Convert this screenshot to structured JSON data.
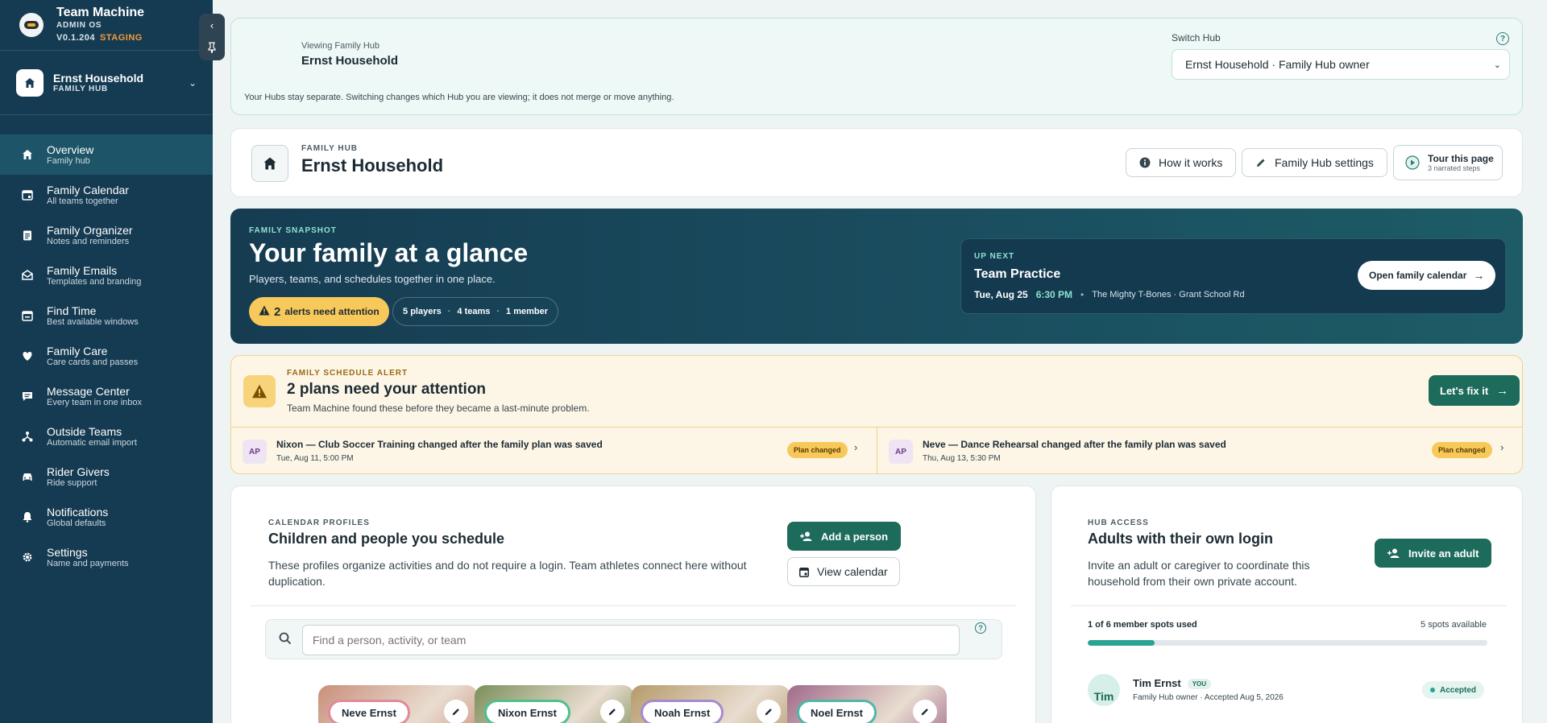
{
  "app": {
    "title": "Team Machine",
    "subtitle": "ADMIN OS",
    "version": "V0.1.204",
    "env": "STAGING"
  },
  "hub_switch": {
    "name": "Ernst Household",
    "type": "FAMILY HUB"
  },
  "nav": [
    {
      "label": "Overview",
      "sub": "Family hub",
      "icon": "home-icon",
      "active": true
    },
    {
      "label": "Family Calendar",
      "sub": "All teams together",
      "icon": "calendar-icon"
    },
    {
      "label": "Family Organizer",
      "sub": "Notes and reminders",
      "icon": "clipboard-icon"
    },
    {
      "label": "Family Emails",
      "sub": "Templates and branding",
      "icon": "mail-icon"
    },
    {
      "label": "Find Time",
      "sub": "Best available windows",
      "icon": "calendar-search-icon"
    },
    {
      "label": "Family Care",
      "sub": "Care cards and passes",
      "icon": "heart-icon"
    },
    {
      "label": "Message Center",
      "sub": "Every team in one inbox",
      "icon": "chat-icon"
    },
    {
      "label": "Outside Teams",
      "sub": "Automatic email import",
      "icon": "network-icon"
    },
    {
      "label": "Rider Givers",
      "sub": "Ride support",
      "icon": "car-icon"
    },
    {
      "label": "Notifications",
      "sub": "Global defaults",
      "icon": "bell-icon"
    },
    {
      "label": "Settings",
      "sub": "Name and payments",
      "icon": "gear-icon"
    }
  ],
  "viewing": {
    "label": "Viewing Family Hub",
    "name": "Ernst Household",
    "note": "Your Hubs stay separate. Switching changes which Hub you are viewing; it does not merge or move anything.",
    "switch_label": "Switch Hub",
    "switch_value": "Ernst Household · Family Hub owner"
  },
  "hub_header": {
    "label": "FAMILY HUB",
    "title": "Ernst Household",
    "how_it_works": "How it works",
    "settings": "Family Hub settings",
    "tour_title": "Tour this page",
    "tour_sub": "3 narrated steps"
  },
  "snapshot": {
    "label": "FAMILY SNAPSHOT",
    "title": "Your family at a glance",
    "subtitle": "Players, teams, and schedules together in one place.",
    "alerts_count": "2",
    "alerts_text": "alerts need attention",
    "players_n": "5",
    "players_l": "players",
    "teams_n": "4",
    "teams_l": "teams",
    "members_n": "1",
    "members_l": "member",
    "up_next_label": "UP NEXT",
    "up_next_title": "Team Practice",
    "up_next_date": "Tue, Aug 25",
    "up_next_time": "6:30 PM",
    "up_next_loc": "The Mighty T-Bones · Grant School Rd",
    "open_calendar": "Open family calendar"
  },
  "schedule_alert": {
    "label": "FAMILY SCHEDULE ALERT",
    "title": "2 plans need your attention",
    "subtitle": "Team Machine found these before they became a last-minute problem.",
    "fix_button": "Let's fix it",
    "items": [
      {
        "initials": "AP",
        "title": "Nixon — Club Soccer Training changed after the family plan was saved",
        "date": "Tue, Aug 11, 5:00 PM",
        "badge": "Plan changed"
      },
      {
        "initials": "AP",
        "title": "Neve — Dance Rehearsal changed after the family plan was saved",
        "date": "Thu, Aug 13, 5:30 PM",
        "badge": "Plan changed"
      }
    ]
  },
  "profiles": {
    "label": "CALENDAR PROFILES",
    "title": "Children and people you schedule",
    "desc": "These profiles organize activities and do not require a login. Team athletes connect here without duplication.",
    "add_button": "Add a person",
    "view_calendar": "View calendar",
    "search_placeholder": "Find a person, activity, or team",
    "people": [
      {
        "name": "Neve Ernst",
        "border": "#e08a9a",
        "bg": "#c98f7a"
      },
      {
        "name": "Nixon Ernst",
        "border": "#4fc08d",
        "bg": "#7a8f5a"
      },
      {
        "name": "Noah Ernst",
        "border": "#a58ad0",
        "bg": "#b59a6a"
      },
      {
        "name": "Noel Ernst",
        "border": "#4fb8a8",
        "bg": "#a06a8a"
      }
    ]
  },
  "access": {
    "label": "HUB ACCESS",
    "title": "Adults with their own login",
    "desc": "Invite an adult or caregiver to coordinate this household from their own private account.",
    "invite_button": "Invite an adult",
    "used": "1 of 6 member spots used",
    "available": "5 spots available",
    "progress": 0.1667,
    "member": {
      "avatar": "Tim",
      "name": "Tim Ernst",
      "you": "YOU",
      "sub": "Family Hub owner · Accepted Aug 5, 2026",
      "status": "Accepted"
    }
  }
}
